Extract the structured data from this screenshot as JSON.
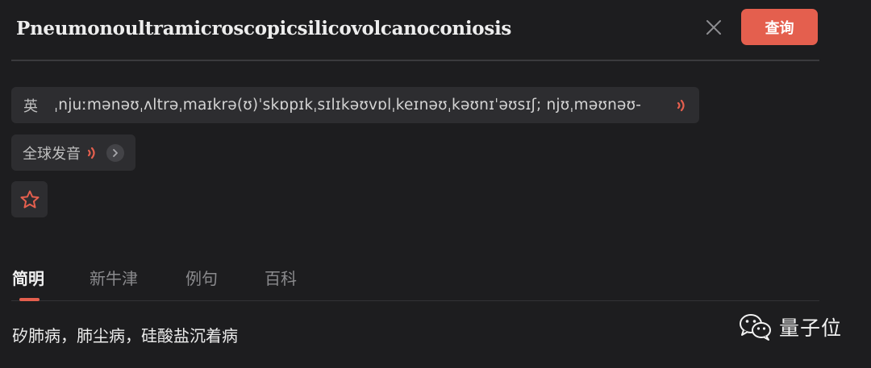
{
  "header": {
    "word": "Pneumonoultramicroscopicsilicovolcanoconiosis",
    "close_icon": "close-icon",
    "search_label": "查询"
  },
  "pronunciation": {
    "region": "英",
    "phonetic": "ˌnjuːmənəʊˌʌltrəˌmaɪkrə(ʊ)ˈskɒpɪkˌsɪlɪkəʊvɒlˌkeɪnəʊˌkəʊnɪˈəʊsɪʃ; njʊˌməʊnəʊ-",
    "speaker_icon": "speaker-icon",
    "speaker_color": "#e45f4e"
  },
  "global_pronunciation": {
    "label": "全球发音",
    "speaker_icon": "speaker-icon",
    "chevron_icon": "chevron-right-icon"
  },
  "favorite": {
    "icon": "star-outline-icon",
    "color": "#e45f4e"
  },
  "tabs": [
    {
      "label": "简明",
      "active": true
    },
    {
      "label": "新牛津",
      "active": false
    },
    {
      "label": "例句",
      "active": false
    },
    {
      "label": "百科",
      "active": false
    }
  ],
  "definition": "矽肺病，肺尘病，硅酸盐沉着病",
  "watermark": {
    "icon": "wechat-icon",
    "text": "量子位"
  },
  "colors": {
    "background": "#1d1d1f",
    "accent": "#e45f4e",
    "pill": "#2d2d30"
  }
}
